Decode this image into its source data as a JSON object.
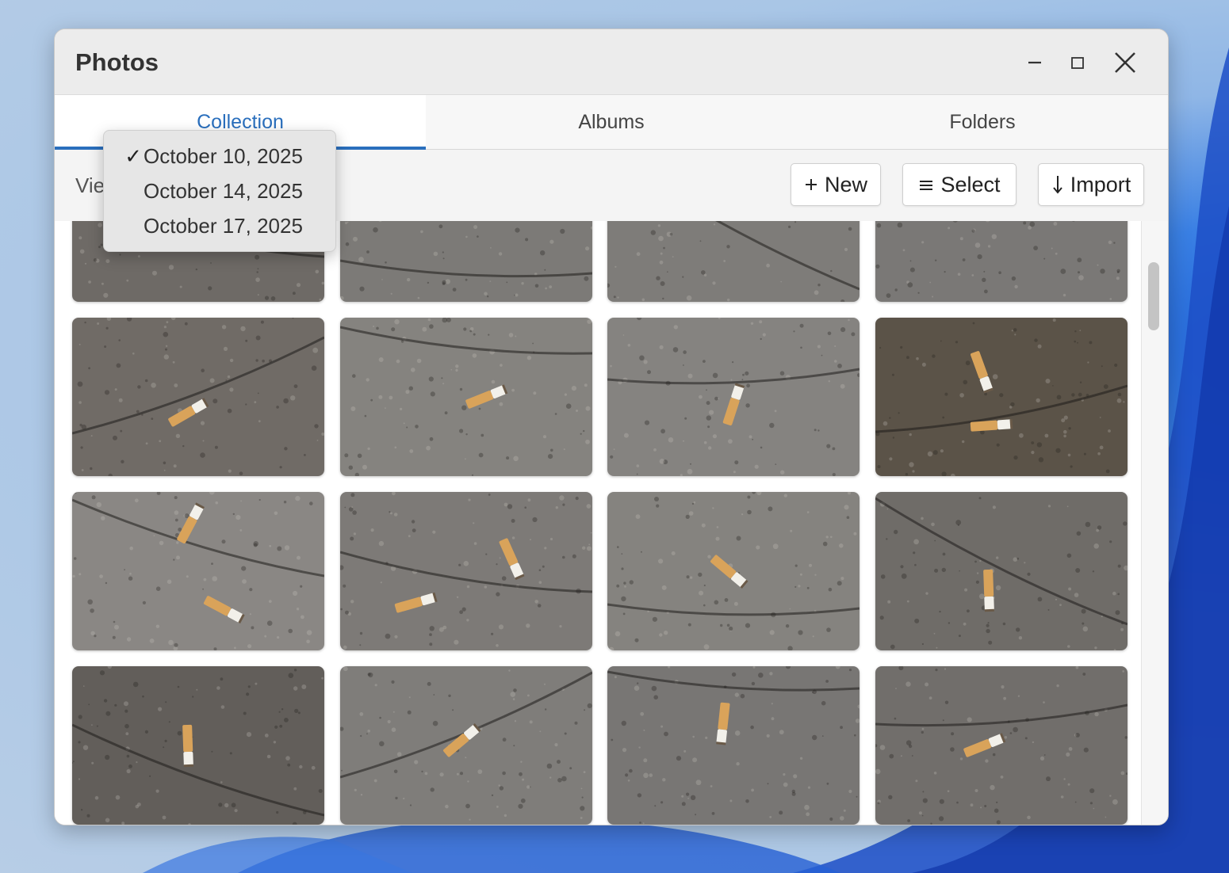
{
  "window": {
    "title": "Photos"
  },
  "tabs": [
    {
      "label": "Collection",
      "active": true
    },
    {
      "label": "Albums",
      "active": false
    },
    {
      "label": "Folders",
      "active": false
    }
  ],
  "toolbar": {
    "view_by_label": "View By",
    "new_label": "New",
    "select_label": "Select",
    "import_label": "Import"
  },
  "view_by_menu": {
    "options": [
      "October 10, 2025",
      "October 14, 2025",
      "October 17, 2025"
    ],
    "selected": "October 10, 2025",
    "check_glyph": "✓"
  },
  "icons": {
    "new": "plus-icon",
    "select": "list-icon",
    "import": "arrow-down-icon",
    "minimize": "minimize-icon",
    "maximize": "maximize-icon",
    "close": "close-icon"
  },
  "colors": {
    "accent": "#2a6fbd",
    "window_bg": "#f4f4f4",
    "pavement": "#7d7b78",
    "filter_orange": "#d9a35a"
  },
  "photos": [
    {
      "ground": "#6e6a66",
      "butts": [
        [
          0.42,
          0.22,
          34
        ]
      ]
    },
    {
      "ground": "#7c7a77",
      "butts": [
        [
          0.42,
          0.04,
          60
        ]
      ]
    },
    {
      "ground": "#7e7c79",
      "butts": [
        [
          0.52,
          0.38,
          -8
        ]
      ]
    },
    {
      "ground": "#7a7876",
      "butts": [
        [
          0.5,
          0.16,
          -18
        ]
      ]
    },
    {
      "ground": "#706b66",
      "butts": [
        [
          0.46,
          0.6,
          -30
        ]
      ]
    },
    {
      "ground": "#85837f",
      "butts": [
        [
          0.58,
          0.5,
          -22
        ]
      ]
    },
    {
      "ground": "#858380",
      "butts": [
        [
          0.5,
          0.55,
          -72
        ]
      ]
    },
    {
      "ground": "#5b5348",
      "butts": [
        [
          0.42,
          0.34,
          70
        ],
        [
          0.46,
          0.68,
          -4
        ]
      ]
    },
    {
      "ground": "#8a8784",
      "butts": [
        [
          0.47,
          0.2,
          -62
        ],
        [
          0.6,
          0.74,
          28
        ]
      ]
    },
    {
      "ground": "#7d7a77",
      "butts": [
        [
          0.68,
          0.42,
          66
        ],
        [
          0.3,
          0.7,
          -16
        ]
      ]
    },
    {
      "ground": "#85837f",
      "butts": [
        [
          0.48,
          0.5,
          40
        ]
      ]
    },
    {
      "ground": "#6f6c68",
      "butts": [
        [
          0.45,
          0.62,
          88
        ]
      ]
    },
    {
      "ground": "#625e5a",
      "butts": [
        [
          0.46,
          0.5,
          88
        ]
      ]
    },
    {
      "ground": "#7f7d7a",
      "butts": [
        [
          0.48,
          0.47,
          -40
        ]
      ]
    },
    {
      "ground": "#787674",
      "butts": [
        [
          0.46,
          0.36,
          96
        ]
      ]
    },
    {
      "ground": "#716e6b",
      "butts": [
        [
          0.43,
          0.5,
          -22
        ]
      ]
    }
  ]
}
